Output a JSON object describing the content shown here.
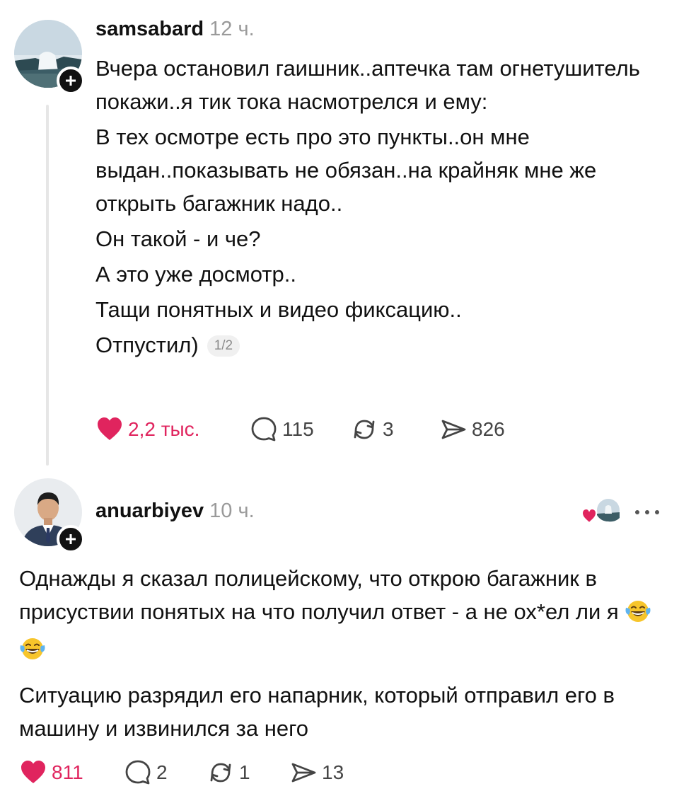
{
  "colors": {
    "like": "#e0245e",
    "text": "#111111",
    "muted": "#9a9a9a",
    "line": "#e6e6e6"
  },
  "posts": [
    {
      "username": "samsabard",
      "time": "12 ч.",
      "avatar_icon": "waterfall-avatar",
      "paragraphs": [
        "Вчера остановил гаишник..аптечка там огнетушитель покажи..я тик тока насмотрелся и ему:",
        "В тех осмотре есть про это пункты..он мне выдан..показывать не обязан..на крайняк мне же открыть багажник надо..",
        "Он такой - и че?",
        "А это уже досмотр..",
        "Тащи понятных и видео фиксацию..",
        "Отпустил)"
      ],
      "pager": "1/2",
      "likes": "2,2 тыс.",
      "liked": true,
      "replies": "115",
      "reposts": "3",
      "shares": "826"
    },
    {
      "username": "anuarbiyev",
      "time": "10 ч.",
      "avatar_icon": "man-in-suit-avatar",
      "paragraphs": [
        "Однажды я сказал полицейскому, что открою багажник в присуствии понятых на что получил ответ - а не ох*ел ли я",
        "Ситуацию разрядил его напарник, который отправил его в машину и извинился за него"
      ],
      "emoji_icons": [
        "laughing-crying-emoji",
        "laughing-crying-emoji"
      ],
      "likes": "811",
      "liked": true,
      "replies": "2",
      "reposts": "1",
      "shares": "13"
    }
  ]
}
